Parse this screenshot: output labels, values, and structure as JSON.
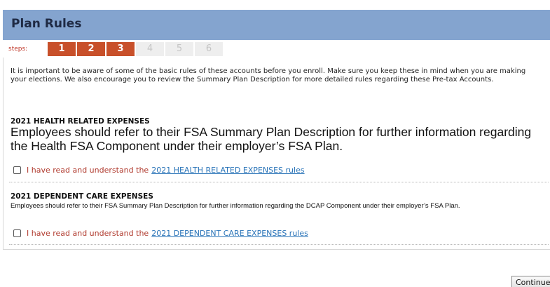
{
  "header": {
    "title": "Plan Rules"
  },
  "steps": {
    "label": "steps:",
    "items": [
      {
        "number": "1",
        "state": "done"
      },
      {
        "number": "2",
        "state": "done"
      },
      {
        "number": "3",
        "state": "done"
      },
      {
        "number": "4",
        "state": "todo"
      },
      {
        "number": "5",
        "state": "todo"
      },
      {
        "number": "6",
        "state": "todo"
      }
    ],
    "colors": {
      "done": "#c8502a",
      "todo": "#eeeeee"
    }
  },
  "intro": {
    "text": "It is important to be aware of some of the basic rules of these accounts before you enroll. Make sure you keep these in mind when you are making your elections. We also encourage you to review the Summary Plan Description for more detailed rules regarding these Pre-tax Accounts."
  },
  "sections": [
    {
      "title": "2021 HEALTH RELATED EXPENSES",
      "description": "Employees should refer to their FSA Summary Plan Description for further information regarding the Health FSA Component under their employer’s FSA Plan.",
      "ack_prefix": "I have read and understand the",
      "ack_link": "2021 HEALTH RELATED EXPENSES rules",
      "checked": false
    },
    {
      "title": "2021 DEPENDENT CARE EXPENSES",
      "description": "Employees should refer to their FSA Summary Plan Description for further information regarding the DCAP Component under their employer’s FSA Plan.",
      "ack_prefix": "I have read and understand the",
      "ack_link": "2021 DEPENDENT CARE EXPENSES rules",
      "checked": false
    }
  ],
  "actions": {
    "continue_label": "Continue"
  },
  "colors": {
    "header_bg": "#84a4cf",
    "link": "#2a74b8",
    "ack_text": "#b03a2e"
  }
}
